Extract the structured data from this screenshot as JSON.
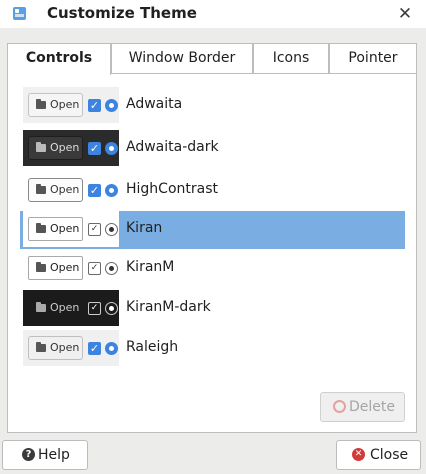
{
  "window": {
    "title": "Customize Theme",
    "close_glyph": "✕",
    "app_icon": "theme-icon"
  },
  "tabs": [
    {
      "label": "Controls",
      "active": true
    },
    {
      "label": "Window Border",
      "active": false
    },
    {
      "label": "Icons",
      "active": false
    },
    {
      "label": "Pointer",
      "active": false
    }
  ],
  "themes": [
    {
      "name": "Adwaita",
      "preview_button": "Open",
      "selected": false
    },
    {
      "name": "Adwaita-dark",
      "preview_button": "Open",
      "selected": false
    },
    {
      "name": "HighContrast",
      "preview_button": "Open",
      "selected": false
    },
    {
      "name": "Kiran",
      "preview_button": "Open",
      "selected": true
    },
    {
      "name": "KiranM",
      "preview_button": "Open",
      "selected": false
    },
    {
      "name": "KiranM-dark",
      "preview_button": "Open",
      "selected": false
    },
    {
      "name": "Raleigh",
      "preview_button": "Open",
      "selected": false
    }
  ],
  "actions": {
    "delete_label": "Delete",
    "delete_enabled": false
  },
  "footer": {
    "help_label": "Help",
    "close_label": "Close"
  },
  "colors": {
    "selection": "#7aaee3",
    "accent": "#3d83e0",
    "danger": "#d23b3b"
  }
}
